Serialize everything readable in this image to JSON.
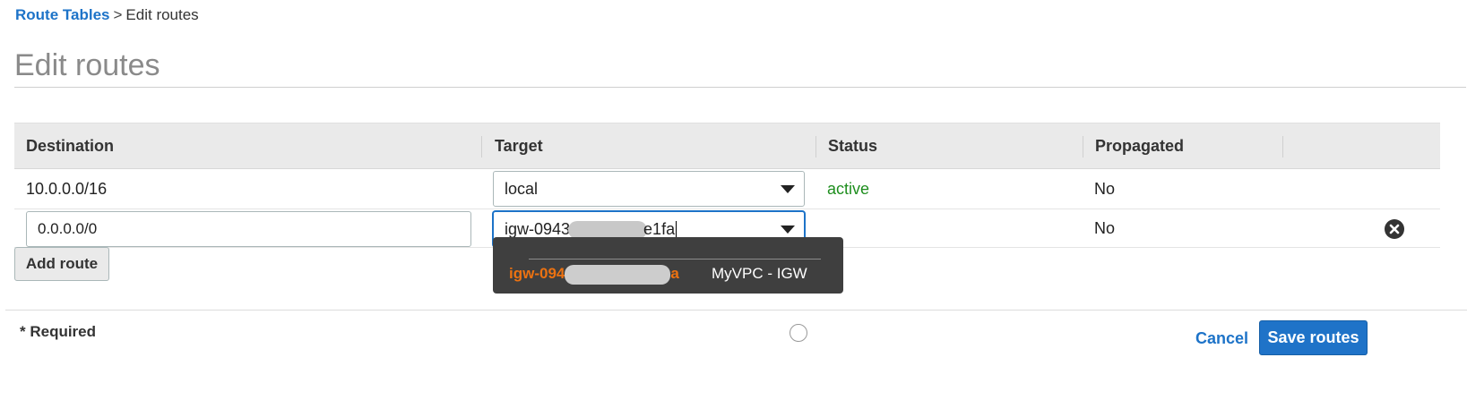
{
  "breadcrumb": {
    "parent": "Route Tables",
    "separator": ">",
    "current": "Edit routes"
  },
  "page": {
    "title": "Edit routes"
  },
  "table": {
    "headers": [
      "Destination",
      "Target",
      "Status",
      "Propagated"
    ],
    "rows": [
      {
        "destination": "10.0.0.0/16",
        "target": "local",
        "status": "active",
        "propagated": "No"
      },
      {
        "destination": "0.0.0.0/0",
        "target_prefix": "igw-0943",
        "target_suffix": "e1fa",
        "status": "",
        "propagated": "No"
      }
    ]
  },
  "dropdown": {
    "option_id_prefix": "igw-094",
    "option_id_suffix": "a",
    "option_name": "MyVPC - IGW"
  },
  "buttons": {
    "add_route": "Add route",
    "cancel": "Cancel",
    "save": "Save routes"
  },
  "footer": {
    "required": "* Required"
  },
  "colors": {
    "link": "#1d73c8",
    "status_active": "#1e8e1e",
    "dropdown_bg": "#3f3f3f",
    "option_highlight": "#ec7211",
    "primary_button": "#1f73c8"
  }
}
